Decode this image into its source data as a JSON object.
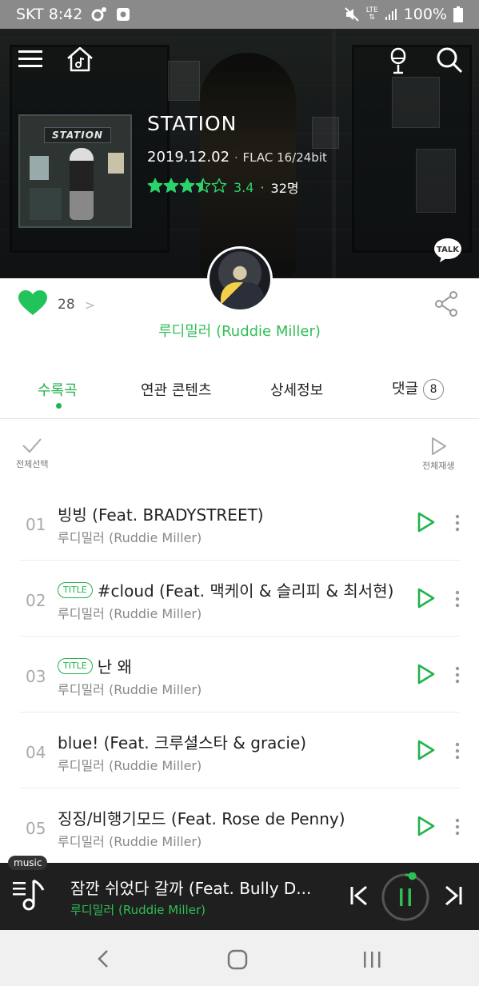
{
  "status_bar": {
    "carrier_time": "SKT 8:42",
    "network": "LTE",
    "battery": "100%"
  },
  "album": {
    "title": "STATION",
    "art_banner": "STATION",
    "release_date": "2019.12.02",
    "format": "FLAC 16/24bit",
    "rating_score": "3.4",
    "rating_count": "32명",
    "rating_stars": 3.5
  },
  "talk_label": "TALK",
  "like": {
    "count": "28",
    "chevron": ">"
  },
  "artist": {
    "name": "루디밀러 (Ruddie Miller)"
  },
  "tabs": [
    {
      "label": "수록곡"
    },
    {
      "label": "연관 콘텐츠"
    },
    {
      "label": "상세정보"
    },
    {
      "label": "댓글",
      "badge": "8"
    }
  ],
  "actions": {
    "select_all": "전체선택",
    "play_all": "전체재생"
  },
  "tracks": [
    {
      "num": "01",
      "title": "빙빙 (Feat. BRADYSTREET)",
      "artist": "루디밀러 (Ruddie Miller)",
      "badge": ""
    },
    {
      "num": "02",
      "title": "#cloud (Feat. 맥케이 & 슬리피 & 최서현)",
      "artist": "루디밀러 (Ruddie Miller)",
      "badge": "TITLE"
    },
    {
      "num": "03",
      "title": "난 왜",
      "artist": "루디밀러 (Ruddie Miller)",
      "badge": "TITLE"
    },
    {
      "num": "04",
      "title": "blue! (Feat. 크루셜스타 & gracie)",
      "artist": "루디밀러 (Ruddie Miller)",
      "badge": ""
    },
    {
      "num": "05",
      "title": "징징/비행기모드 (Feat. Rose de Penny)",
      "artist": "루디밀러 (Ruddie Miller)",
      "badge": ""
    }
  ],
  "mini_player": {
    "tag": "music",
    "title": "잠깐 쉬었다 갈까 (Feat. Bully D...",
    "artist": "루디밀러 (Ruddie Miller)",
    "progress": 0.05
  },
  "colors": {
    "accent": "#22b24c",
    "artist_green": "#2fbf55",
    "heart": "#22c35a"
  }
}
